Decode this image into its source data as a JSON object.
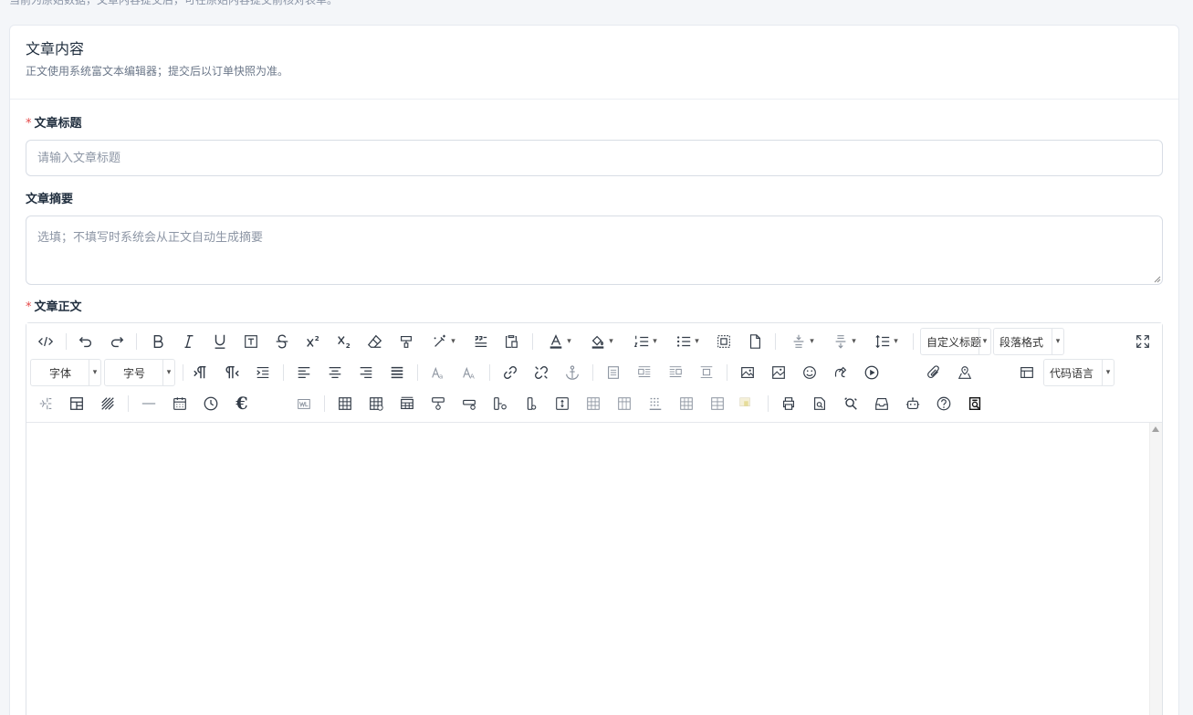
{
  "top_note": "当前为原始数据，文章内容提交后，可在原始内容提交前核对表单。",
  "card": {
    "title": "文章内容",
    "description": "正文使用系统富文本编辑器；提交后以订单快照为准。"
  },
  "fields": {
    "title": {
      "label": "文章标题",
      "required": true,
      "placeholder": "请输入文章标题",
      "value": ""
    },
    "summary": {
      "label": "文章摘要",
      "required": false,
      "placeholder": "选填；不填写时系统会从正文自动生成摘要",
      "value": ""
    },
    "body": {
      "label": "文章正文",
      "required": true
    }
  },
  "toolbar": {
    "custom_heading": "自定义标题",
    "paragraph_format": "段落格式",
    "font_family": "字体",
    "font_size": "字号",
    "code_language": "代码语言",
    "required_mark": "*"
  },
  "colors": {
    "accent": "#e54848",
    "border": "#d8dde5",
    "text": "#1f2d3d",
    "muted": "#6b7789",
    "background": "#f4f6f9"
  }
}
